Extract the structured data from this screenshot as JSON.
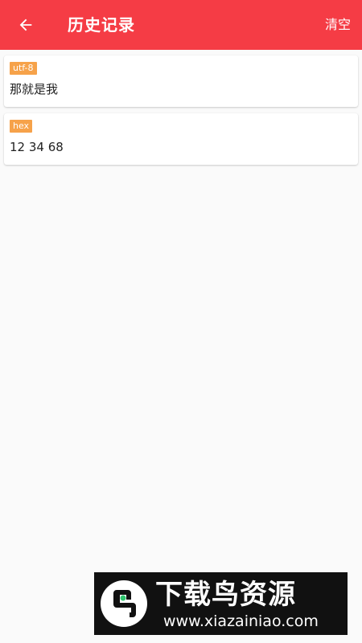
{
  "header": {
    "title": "历史记录",
    "back_icon": "arrow-left-icon",
    "clear_label": "清空",
    "bg_color": "#f53c45"
  },
  "history": {
    "items": [
      {
        "encoding": "utf-8",
        "content": "那就是我"
      },
      {
        "encoding": "hex",
        "content": "12 34 68"
      }
    ],
    "badge_color": "#f6a24a"
  },
  "watermark": {
    "brand": "下载鸟资源",
    "url": "www.xiazainiao.com"
  }
}
